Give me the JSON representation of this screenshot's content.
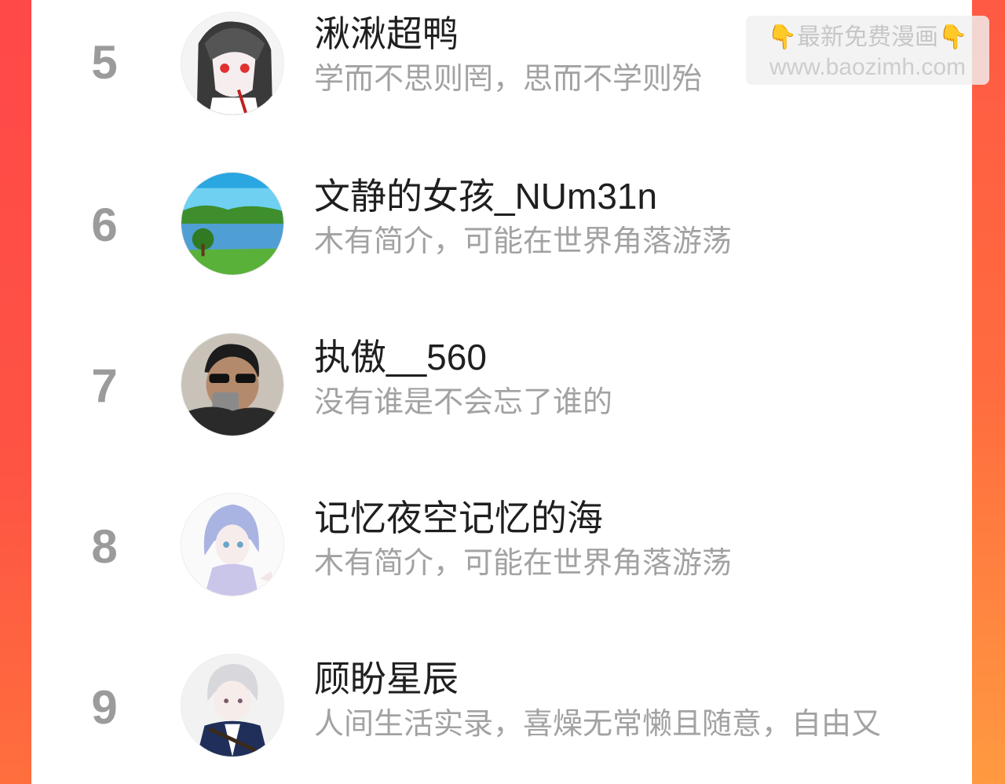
{
  "ranking": {
    "rows": [
      {
        "rank": "5",
        "name": "湫湫超鸭",
        "bio": "学而不思则罔，思而不学则殆"
      },
      {
        "rank": "6",
        "name": "文静的女孩_NUm31n",
        "bio": "木有简介，可能在世界角落游荡"
      },
      {
        "rank": "7",
        "name": "执傲__560",
        "bio": "没有谁是不会忘了谁的"
      },
      {
        "rank": "8",
        "name": "记忆夜空记忆的海",
        "bio": "木有简介，可能在世界角落游荡"
      },
      {
        "rank": "9",
        "name": "顾盼星辰",
        "bio": "人间生活实录，喜燥无常懒且随意，自由又"
      }
    ]
  },
  "watermark": {
    "title": "最新免费漫画",
    "url": "www.baozimh.com"
  },
  "colors": {
    "frame_red": "#fe4a44",
    "frame_orange": "#ff8a3c",
    "rank_gray": "#9b9b9b",
    "name_dark": "#1f1f1f",
    "bio_gray": "#a2a2a2"
  }
}
